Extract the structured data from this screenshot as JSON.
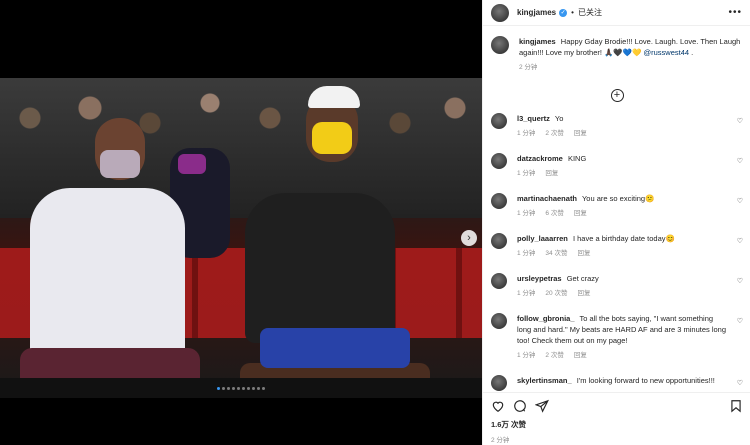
{
  "header": {
    "username": "kingjames",
    "separator": "•",
    "follow_label": "已关注",
    "more_label": "•••"
  },
  "caption": {
    "username": "kingjames",
    "text": "Happy Gday Brodie!!! Love. Laugh. Love. Then Laugh again!!! Love my brother! 🙏🏿🖤💙💛",
    "mention": "@russwest44",
    "suffix": " .",
    "time": "2 分钟"
  },
  "comments": [
    {
      "username": "l3_quertz",
      "text": "Yo",
      "time": "1 分钟",
      "likes": "2 次赞",
      "reply": "回复"
    },
    {
      "username": "datzackrome",
      "text": "KING",
      "time": "1 分钟",
      "likes": "",
      "reply": "回复"
    },
    {
      "username": "martinachaenath",
      "text": "You are so exciting😕",
      "time": "1 分钟",
      "likes": "6 次赞",
      "reply": "回复"
    },
    {
      "username": "polly_laaarren",
      "text": "I have a birthday date today😊",
      "time": "1 分钟",
      "likes": "34 次赞",
      "reply": "回复"
    },
    {
      "username": "ursleypetras",
      "text": "Get crazy",
      "time": "1 分钟",
      "likes": "20 次赞",
      "reply": "回复"
    },
    {
      "username": "follow_gbronia_",
      "text": "To all the bots saying, \"I want something long and hard.\" My beats are HARD AF and are 3 minutes long too! Check them out on my page!",
      "time": "1 分钟",
      "likes": "2 次赞",
      "reply": "回复"
    },
    {
      "username": "skylertinsman_",
      "text": "I'm looking forward to new opportunities!!!",
      "time": "",
      "likes": "",
      "reply": ""
    }
  ],
  "footer": {
    "likes": "1.6万 次赞",
    "time": "2 分钟"
  },
  "media": {
    "next_arrow": "›",
    "dots_count": 10,
    "active_dot": 0
  },
  "colors": {
    "accent": "#3897f0",
    "mention": "#00376b",
    "muted": "#8e8e8e"
  }
}
